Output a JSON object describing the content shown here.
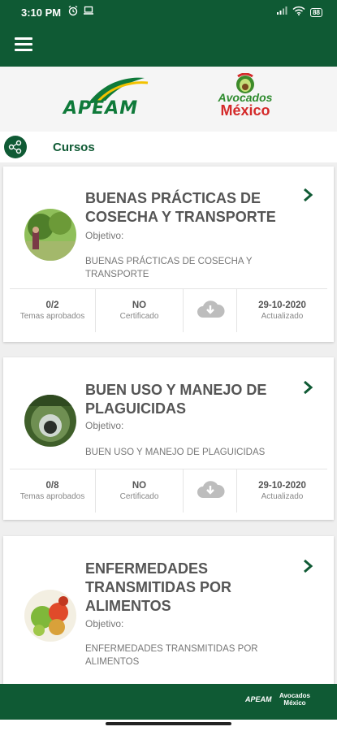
{
  "status": {
    "time": "3:10 PM",
    "battery": "88"
  },
  "logos": {
    "apeam": "APEAM",
    "avocados_line1": "Avocados",
    "avocados_line2": "México"
  },
  "section": {
    "title": "Cursos"
  },
  "courses": [
    {
      "title": "BUENAS PRÁCTICAS DE COSECHA Y TRANSPORTE",
      "objective_label": "Objetivo:",
      "objective": "BUENAS PRÁCTICAS DE COSECHA Y TRANSPORTE",
      "progress": "0/2",
      "progress_label": "Temas aprobados",
      "certificate": "NO",
      "certificate_label": "Certificado",
      "updated": "29-10-2020",
      "updated_label": "Actualizado"
    },
    {
      "title": "BUEN USO Y MANEJO DE PLAGUICIDAS",
      "objective_label": "Objetivo:",
      "objective": "BUEN USO Y MANEJO DE PLAGUICIDAS",
      "progress": "0/8",
      "progress_label": "Temas aprobados",
      "certificate": "NO",
      "certificate_label": "Certificado",
      "updated": "29-10-2020",
      "updated_label": "Actualizado"
    },
    {
      "title": "ENFERMEDADES TRANSMITIDAS POR ALIMENTOS",
      "objective_label": "Objetivo:",
      "objective": "ENFERMEDADES TRANSMITIDAS POR ALIMENTOS"
    }
  ],
  "colors": {
    "primary": "#0f5a34",
    "title": "#555555",
    "muted": "#777777",
    "download": "#bdbdbd"
  },
  "bottom": {
    "logo1": "APEAM",
    "logo2_line1": "Avocados",
    "logo2_line2": "México"
  }
}
